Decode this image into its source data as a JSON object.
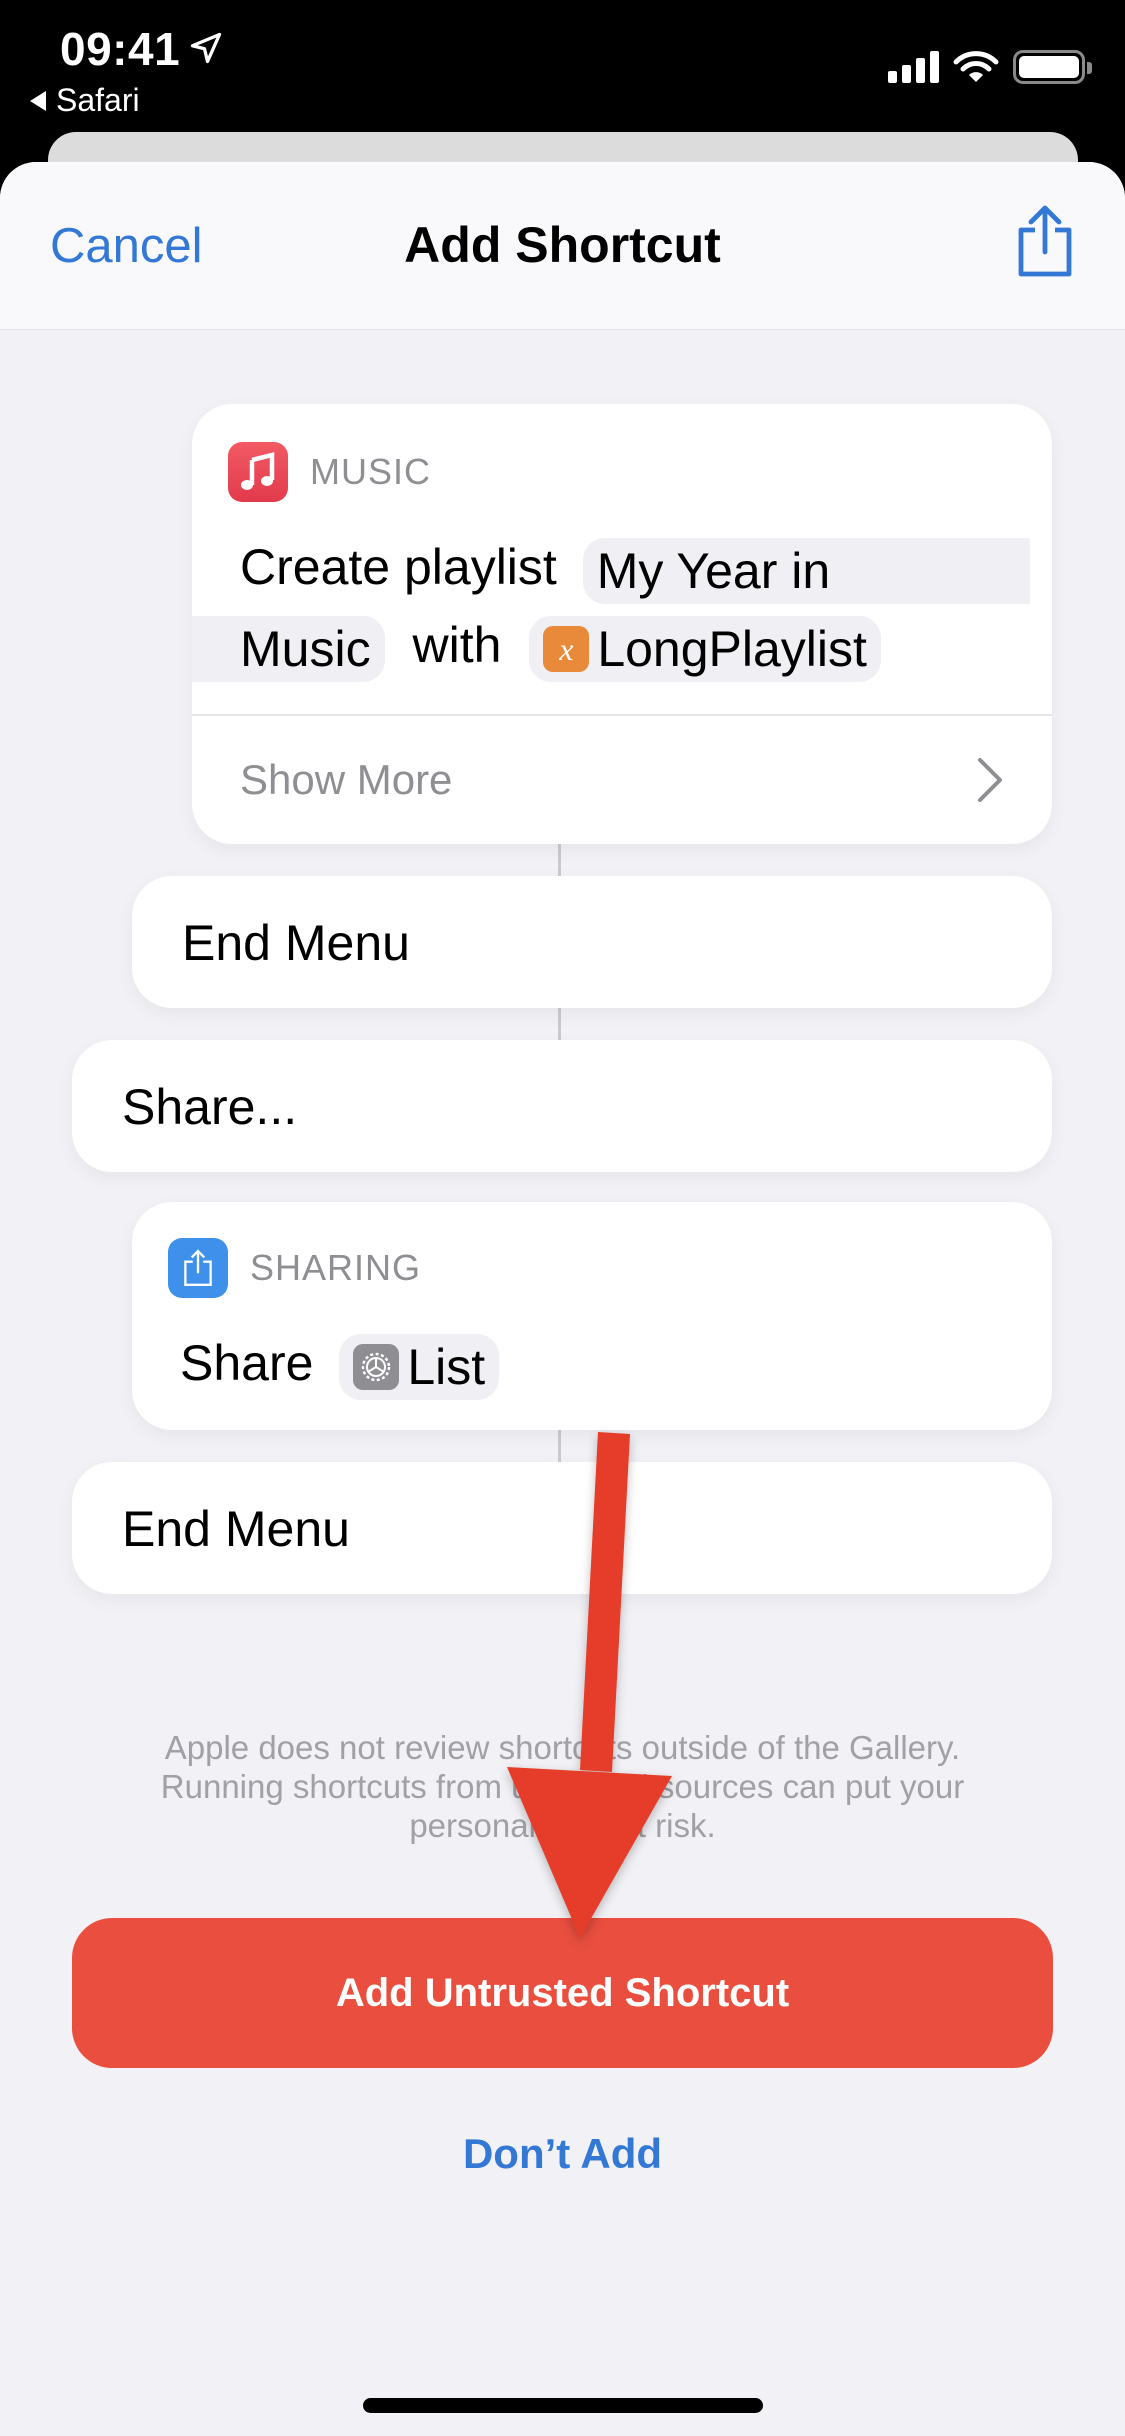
{
  "status_bar": {
    "time": "09:41",
    "back_app": "Safari",
    "icons": [
      "location-arrow-icon",
      "cellular-signal-icon",
      "wifi-icon",
      "battery-icon"
    ]
  },
  "nav": {
    "cancel_label": "Cancel",
    "title": "Add Shortcut",
    "share_icon": "share-icon"
  },
  "actions": {
    "music_card": {
      "app_label": "MUSIC",
      "icon": "music-note-icon",
      "text_create": "Create playlist",
      "token_name_line1": "My Year in",
      "token_name_line2": "Music",
      "text_with": "with",
      "token_variable_badge": "x",
      "token_variable": "LongPlaylist",
      "show_more_label": "Show More"
    },
    "end_menu_1": {
      "label": "End Menu"
    },
    "share_menu_item": {
      "label": "Share..."
    },
    "sharing_card": {
      "app_label": "SHARING",
      "icon": "share-icon",
      "text_share": "Share",
      "token_list": "List"
    },
    "end_menu_2": {
      "label": "End Menu"
    }
  },
  "footer": {
    "warning_line1": "Apple does not review shortcuts outside of the Gallery.",
    "warning_line2": "Running shortcuts from untrusted sources can put your",
    "warning_line3": "personal data at risk.",
    "add_button_label": "Add Untrusted Shortcut",
    "dont_add_label": "Don’t Add"
  },
  "colors": {
    "accent_blue": "#3478d6",
    "danger_red": "#e94e3e",
    "music_red": "#e8404f",
    "sharing_blue": "#3e90ea",
    "variable_orange": "#e88a3a",
    "annotation_arrow": "#e63e2a"
  }
}
